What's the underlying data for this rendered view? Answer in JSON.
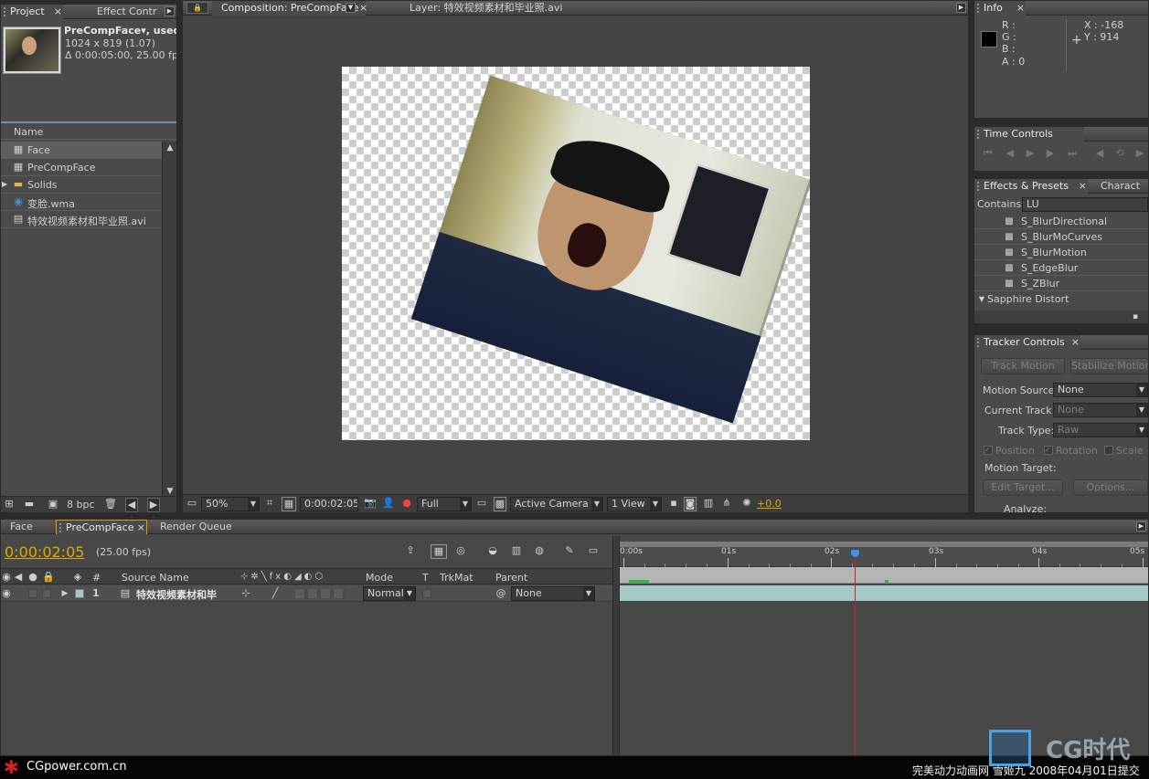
{
  "project": {
    "tabs": [
      "Project",
      "Effect Contr"
    ],
    "comp_name": "PreCompFace",
    "used_suffix": "▾, used",
    "dimensions": "1024 x 819 (1.07)",
    "duration": "Δ 0:00:05:00, 25.00 fps",
    "column_name": "Name",
    "items": [
      {
        "name": "Face",
        "icon": "comp-icon",
        "selected": true
      },
      {
        "name": "PreCompFace",
        "icon": "comp-icon",
        "selected": false
      },
      {
        "name": "Solids",
        "icon": "folder-icon",
        "selected": false
      },
      {
        "name": "变脸.wma",
        "icon": "audio-icon",
        "selected": false
      },
      {
        "name": "特效视频素材和毕业照.avi",
        "icon": "footage-icon",
        "selected": false
      }
    ],
    "bpc": "8 bpc"
  },
  "viewer": {
    "tabs": [
      "Composition: PreCompFace",
      "Layer: 特效视频素材和毕业照.avi"
    ],
    "zoom": "50%",
    "timecode": "0:00:02:05",
    "resolution": "Full",
    "camera": "Active Camera",
    "views": "1 View",
    "exposure": "+0.0"
  },
  "info": {
    "title": "Info",
    "r": "R :",
    "g": "G :",
    "b": "B :",
    "a": "A : 0",
    "x": "X : -168",
    "y": "Y : 914"
  },
  "time_controls": {
    "title": "Time Controls"
  },
  "effects": {
    "tabs": [
      "Effects & Presets",
      "Charact"
    ],
    "contains_label": "Contains:",
    "search_value": "LU",
    "items": [
      "S_BlurDirectional",
      "S_BlurMoCurves",
      "S_BlurMotion",
      "S_EdgeBlur",
      "S_ZBlur"
    ],
    "group": "Sapphire Distort"
  },
  "tracker": {
    "title": "Tracker Controls",
    "track_motion": "Track Motion",
    "stabilize_motion": "Stabilize Motion",
    "motion_source_label": "Motion Source:",
    "motion_source": "None",
    "current_track_label": "Current Track:",
    "current_track": "None",
    "track_type_label": "Track Type:",
    "track_type": "Raw",
    "position": "Position",
    "rotation": "Rotation",
    "scale": "Scale",
    "motion_target_label": "Motion Target:",
    "edit_target": "Edit Target...",
    "options": "Options...",
    "analyze": "Analyze:"
  },
  "timeline": {
    "tabs": [
      "Face",
      "PreCompFace",
      "Render Queue"
    ],
    "timecode": "0:00:02:05",
    "fps": "(25.00 fps)",
    "ruler": [
      "0:00s",
      "01s",
      "02s",
      "03s",
      "04s",
      "05s"
    ],
    "playhead_fraction": 0.445,
    "columns": {
      "num": "#",
      "source": "Source Name",
      "mode": "Mode",
      "t": "T",
      "trkmat": "TrkMat",
      "parent": "Parent"
    },
    "layer": {
      "num": "1",
      "name": "特效视频素材和毕",
      "mode": "Normal",
      "parent": "None"
    }
  },
  "footer": {
    "left": "CGpower.com.cn",
    "right": "完美动力动画网 雪姬九 2008年04月01日提交",
    "logo": "CG时代"
  },
  "colors": {
    "timecode": "#e0a800",
    "playhead": "#d42020",
    "track_bar": "#a5c9c6",
    "accent": "#4a90d9"
  }
}
